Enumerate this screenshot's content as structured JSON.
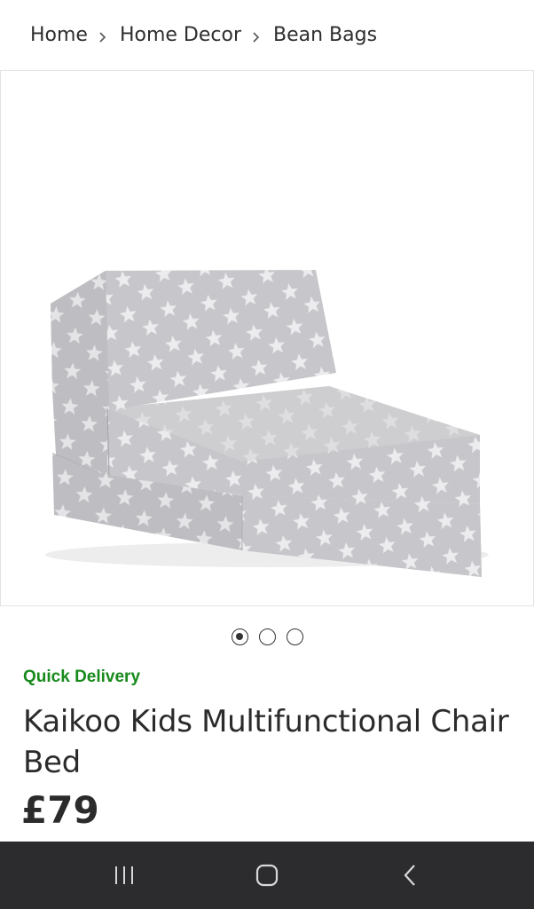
{
  "breadcrumb": {
    "items": [
      "Home",
      "Home Decor",
      "Bean Bags"
    ]
  },
  "gallery": {
    "image_subject": "grey star-print fold-out chair bed",
    "image_count": 3,
    "active_index": 0
  },
  "product": {
    "delivery_badge": "Quick Delivery",
    "title": "Kaikoo Kids Multifunctional Chair Bed",
    "price": "£79"
  },
  "system_nav": {
    "recents_icon": "recents-icon",
    "home_icon": "home-icon",
    "back_icon": "back-icon"
  },
  "colors": {
    "delivery_green": "#188a1c",
    "fabric_grey": "#c9c9cc",
    "nav_bar": "#2c2c2e"
  }
}
